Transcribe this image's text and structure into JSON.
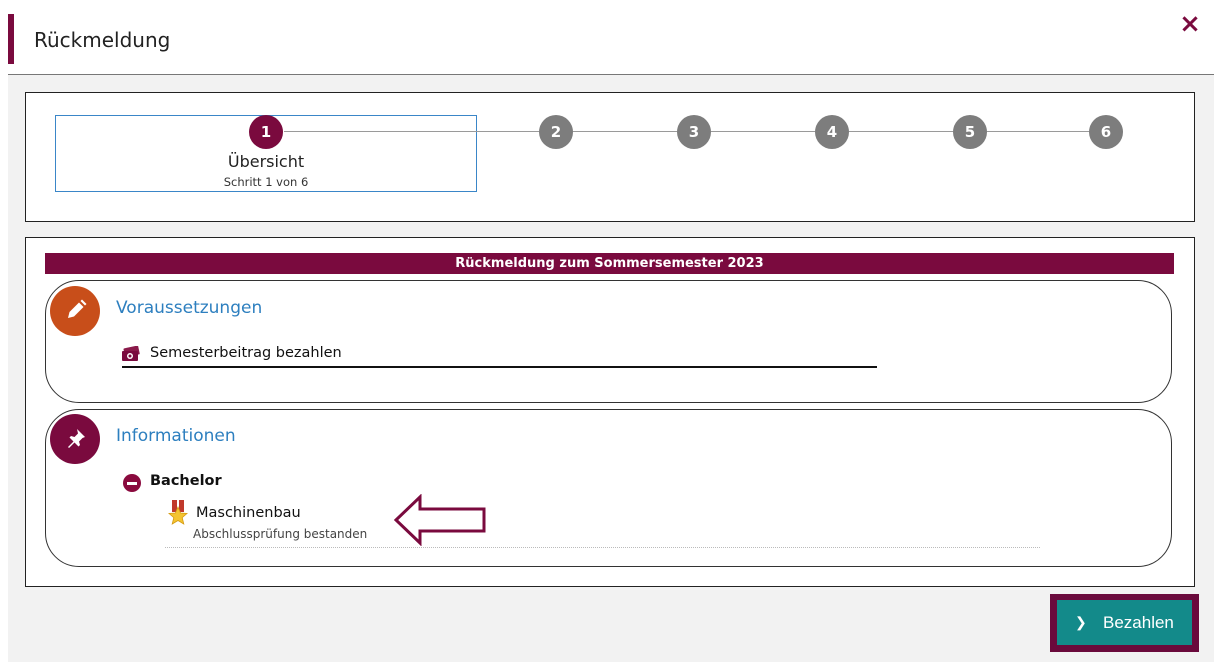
{
  "dialog": {
    "title": "Rückmeldung",
    "close_symbol": "×"
  },
  "stepper": {
    "current_step": 1,
    "steps": [
      "1",
      "2",
      "3",
      "4",
      "5",
      "6"
    ],
    "active_name": "Übersicht",
    "active_sub": "Schritt 1 von 6"
  },
  "main": {
    "header": "Rückmeldung zum Sommersemester 2023",
    "prerequisites": {
      "title": "Voraussetzungen",
      "icon": "pencil-icon",
      "items": [
        {
          "label": "Semesterbeitrag bezahlen",
          "icon": "money-icon"
        }
      ]
    },
    "information": {
      "title": "Informationen",
      "icon": "pin-icon",
      "degree": "Bachelor",
      "subject": "Maschinenbau",
      "status": "Abschlussprüfung bestanden"
    }
  },
  "footer": {
    "pay_label": "Bezahlen"
  },
  "colors": {
    "accent": "#7a0a3e",
    "link": "#2d7fbf",
    "button": "#138a8a",
    "orange": "#c84e1a"
  }
}
